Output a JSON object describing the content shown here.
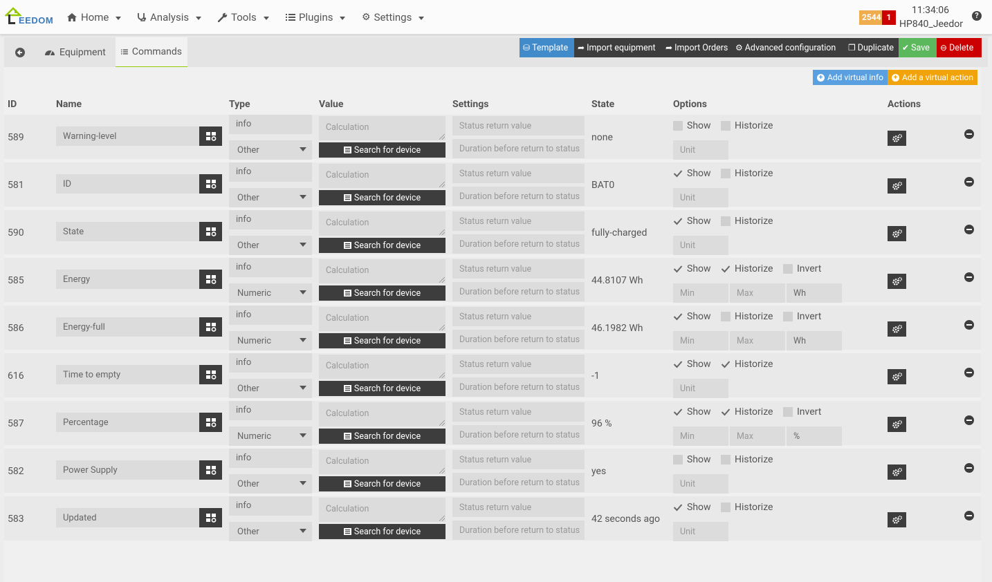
{
  "navbar": {
    "logo_text": "EEDOM",
    "menu": [
      {
        "label": "Home",
        "icon": "home-icon"
      },
      {
        "label": "Analysis",
        "icon": "stethoscope-icon"
      },
      {
        "label": "Tools",
        "icon": "wrench-icon"
      },
      {
        "label": "Plugins",
        "icon": "list-icon"
      },
      {
        "label": "Settings",
        "icon": "cog-icon"
      }
    ],
    "badge_count": "2544",
    "alert_count": "1",
    "time": "11:34:06",
    "hostname": "HP840_Jeedom"
  },
  "tabs": {
    "back_icon": "back-arrow-icon",
    "equipment": "Equipment",
    "commands": "Commands"
  },
  "toolbar": {
    "template": "Template",
    "import_equipment": "Import equipment",
    "import_orders": "Import Orders",
    "advanced_config": "Advanced configuration",
    "duplicate": "Duplicate",
    "save": "Save",
    "delete": "Delete"
  },
  "virtual_buttons": {
    "add_info": "Add virtual info",
    "add_action": "Add a virtual action"
  },
  "table": {
    "headers": {
      "id": "ID",
      "name": "Name",
      "type": "Type",
      "value": "Value",
      "settings": "Settings",
      "state": "State",
      "options": "Options",
      "actions": "Actions"
    },
    "placeholders": {
      "calculation": "Calculation",
      "status_return": "Status return value",
      "duration_return": "Duration before return to status",
      "unit": "Unit",
      "min": "Min",
      "max": "Max"
    },
    "search_label": "Search for device",
    "labels": {
      "show": "Show",
      "historize": "Historize",
      "invert": "Invert"
    },
    "rows": [
      {
        "id": "589",
        "name": "Warning-level",
        "type": "info",
        "subtype": "Other",
        "state": "none",
        "show": false,
        "historize": false,
        "invert": null,
        "unit": ""
      },
      {
        "id": "581",
        "name": "ID",
        "type": "info",
        "subtype": "Other",
        "state": "BAT0",
        "show": true,
        "historize": false,
        "invert": null,
        "unit": ""
      },
      {
        "id": "590",
        "name": "State",
        "type": "info",
        "subtype": "Other",
        "state": "fully-charged",
        "show": true,
        "historize": false,
        "invert": null,
        "unit": ""
      },
      {
        "id": "585",
        "name": "Energy",
        "type": "info",
        "subtype": "Numeric",
        "state": "44.8107 Wh",
        "show": true,
        "historize": true,
        "invert": false,
        "unit": "Wh"
      },
      {
        "id": "586",
        "name": "Energy-full",
        "type": "info",
        "subtype": "Numeric",
        "state": "46.1982 Wh",
        "show": true,
        "historize": false,
        "invert": false,
        "unit": "Wh"
      },
      {
        "id": "616",
        "name": "Time to empty",
        "type": "info",
        "subtype": "Other",
        "state": "-1",
        "show": true,
        "historize": true,
        "invert": null,
        "unit": ""
      },
      {
        "id": "587",
        "name": "Percentage",
        "type": "info",
        "subtype": "Numeric",
        "state": "96 %",
        "show": true,
        "historize": true,
        "invert": false,
        "unit": "%"
      },
      {
        "id": "582",
        "name": "Power Supply",
        "type": "info",
        "subtype": "Other",
        "state": "yes",
        "show": false,
        "historize": false,
        "invert": null,
        "unit": ""
      },
      {
        "id": "583",
        "name": "Updated",
        "type": "info",
        "subtype": "Other",
        "state": "42 seconds ago",
        "show": true,
        "historize": false,
        "invert": null,
        "unit": ""
      }
    ]
  }
}
